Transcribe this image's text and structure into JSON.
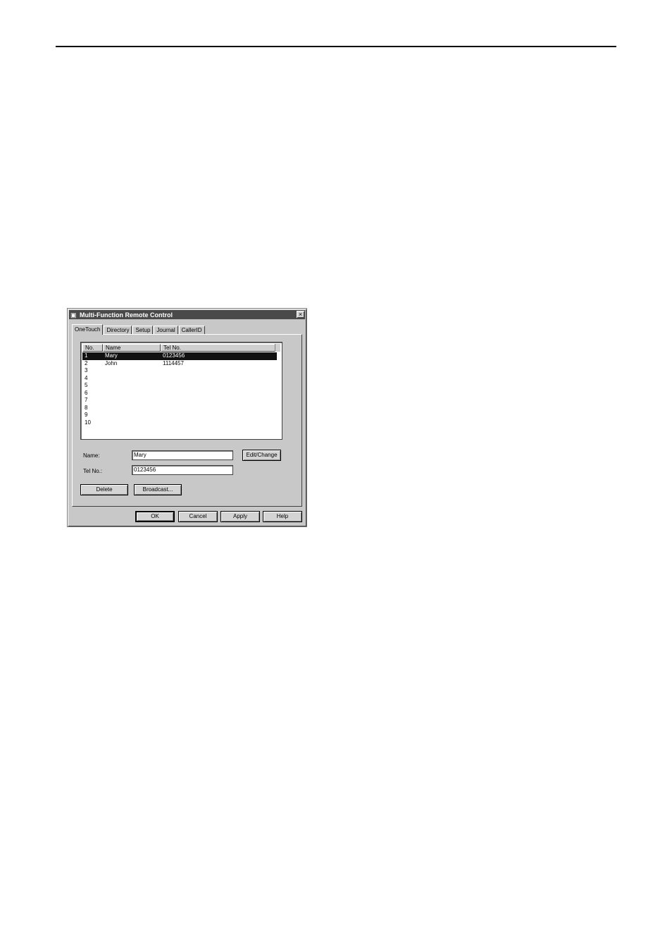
{
  "window": {
    "title": "Multi-Function Remote Control",
    "close_glyph": "×",
    "app_icon": "printer-icon"
  },
  "tabs": [
    "OneTouch",
    "Directory",
    "Setup",
    "Journal",
    "CallerID"
  ],
  "list": {
    "columns": [
      "No.",
      "Name",
      "Tel No."
    ],
    "rows": [
      {
        "no": "1",
        "name": "Mary",
        "tel": "0123456"
      },
      {
        "no": "2",
        "name": "John",
        "tel": "1114457"
      },
      {
        "no": "3",
        "name": "",
        "tel": ""
      },
      {
        "no": "4",
        "name": "",
        "tel": ""
      },
      {
        "no": "5",
        "name": "",
        "tel": ""
      },
      {
        "no": "6",
        "name": "",
        "tel": ""
      },
      {
        "no": "7",
        "name": "",
        "tel": ""
      },
      {
        "no": "8",
        "name": "",
        "tel": ""
      },
      {
        "no": "9",
        "name": "",
        "tel": ""
      },
      {
        "no": "10",
        "name": "",
        "tel": ""
      }
    ]
  },
  "form": {
    "name_label": "Name:",
    "name_value": "Mary",
    "tel_label": "Tel No.:",
    "tel_value": "0123456",
    "edit_button": "Edit/Change",
    "delete_button": "Delete",
    "broadcast_button": "Broadcast..."
  },
  "footer": {
    "ok": "OK",
    "cancel": "Cancel",
    "apply": "Apply",
    "help": "Help"
  }
}
